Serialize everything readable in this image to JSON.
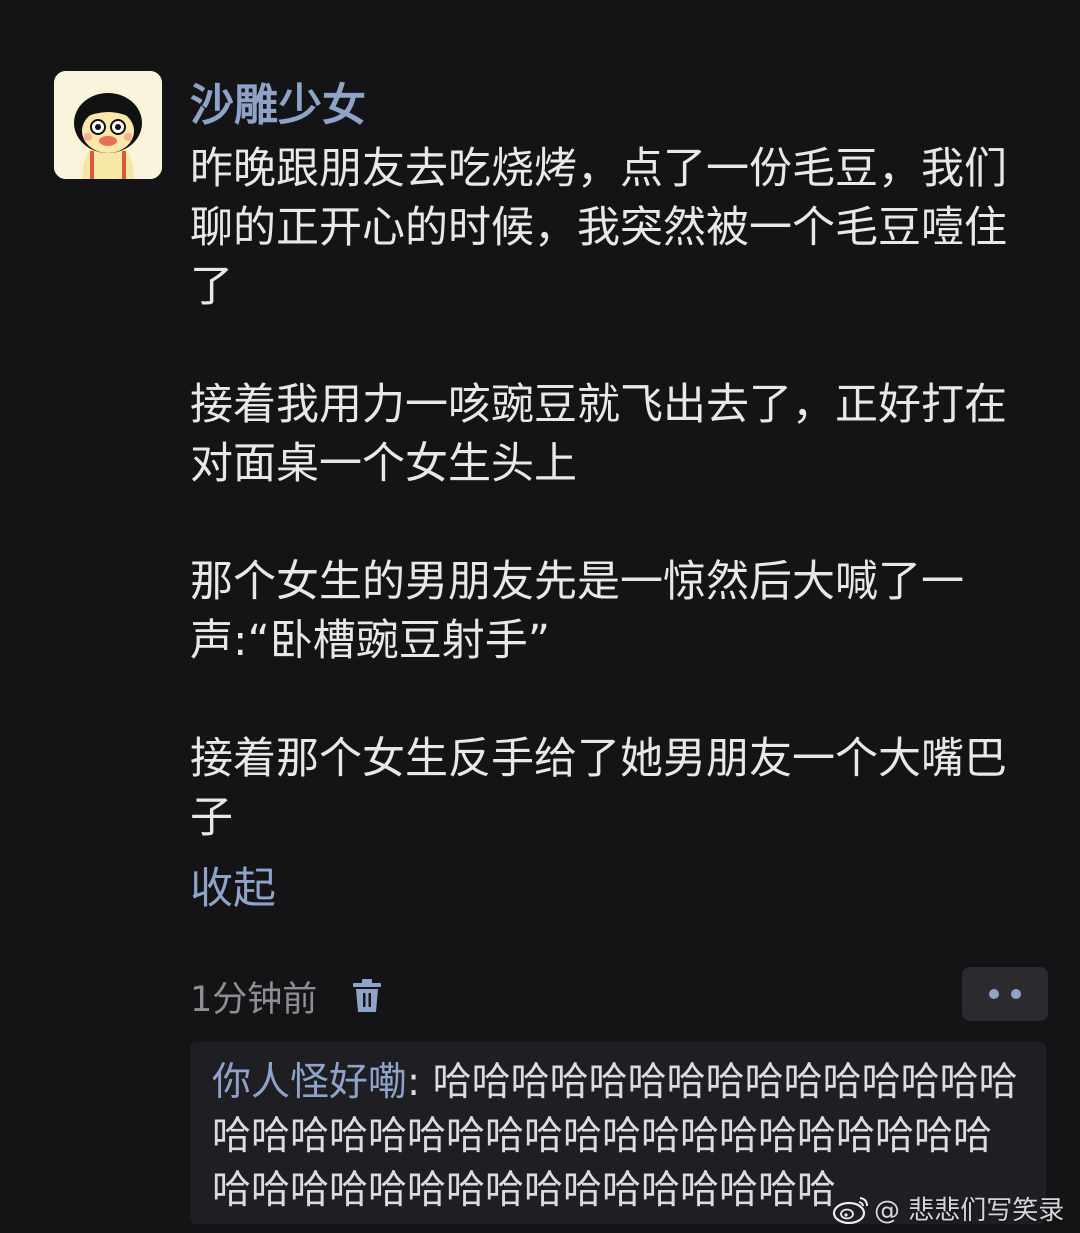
{
  "post": {
    "author": "沙雕少女",
    "avatar_icon": "cartoon-girl-avatar",
    "paragraphs": [
      "昨晚跟朋友去吃烧烤，点了一份毛豆，我们聊的正开心的时候，我突然被一个毛豆噎住了",
      "接着我用力一咳豌豆就飞出去了，正好打在对面桌一个女生头上",
      "那个女生的男朋友先是一惊然后大喊了一声:“卧槽豌豆射手”",
      "接着那个女生反手给了她男朋友一个大嘴巴子"
    ],
    "collapse_label": "收起",
    "timestamp": "1分钟前",
    "delete_icon": "trash-icon",
    "more_icon": "more-dots-icon"
  },
  "reply": {
    "author": "你人怪好嘞",
    "separator": ": ",
    "text": "哈哈哈哈哈哈哈哈哈哈哈哈哈哈哈哈哈哈哈哈哈哈哈哈哈哈哈哈哈哈哈哈哈哈哈哈哈哈哈哈哈哈哈哈哈哈哈哈哈哈哈"
  },
  "watermark": {
    "icon": "weibo-logo-icon",
    "text": "@ 悲悲们写笑录"
  },
  "colors": {
    "background": "#141416",
    "link": "#8fa3c8",
    "text": "#e8e8ea",
    "muted": "#8e8e93",
    "panel": "#1f1f23"
  }
}
